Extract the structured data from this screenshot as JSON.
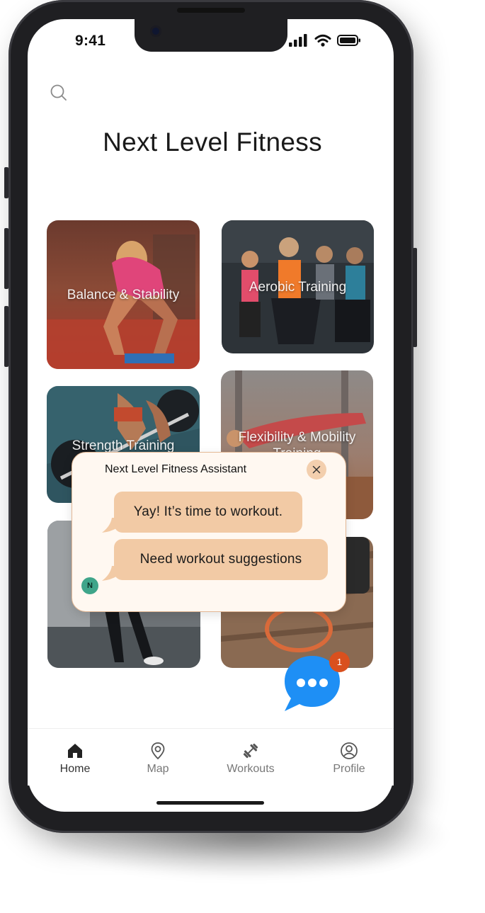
{
  "status": {
    "time": "9:41"
  },
  "header": {
    "title": "Next Level Fitness"
  },
  "categories": [
    {
      "label": "Balance & Stability"
    },
    {
      "label": "Aerobic Training"
    },
    {
      "label": "Strength Training"
    },
    {
      "label": "Flexibility & Mobility Training"
    }
  ],
  "assistant": {
    "title": "Next Level Fitness Assistant",
    "messages": [
      "Yay! It’s time to workout.",
      "Need workout suggestions"
    ],
    "avatar_text": "N"
  },
  "chat_button": {
    "badge_count": "1"
  },
  "nav": {
    "home": "Home",
    "map": "Map",
    "workouts": "Workouts",
    "profile": "Profile"
  },
  "colors": {
    "accent": "#1e8ff5",
    "bubble": "#f2caa5",
    "badge": "#d9501e"
  }
}
